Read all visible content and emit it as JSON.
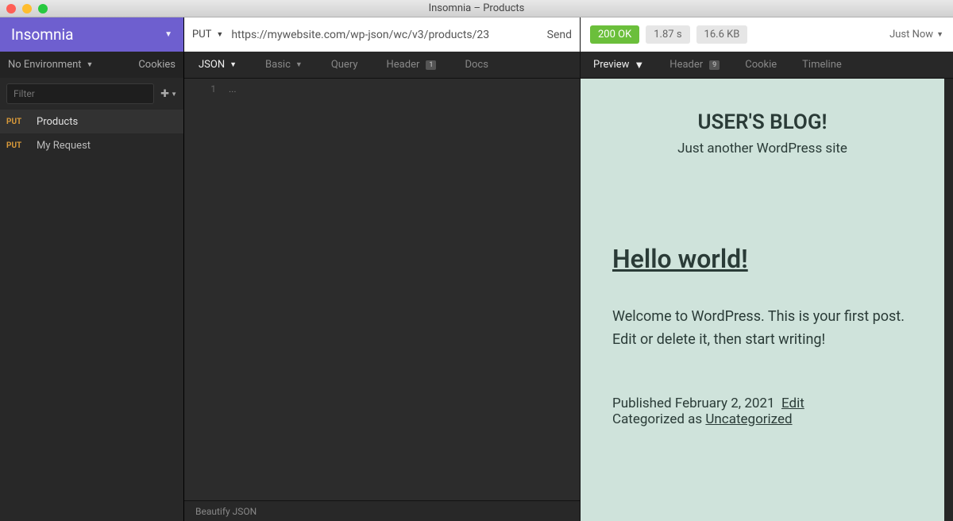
{
  "window": {
    "title": "Insomnia – Products"
  },
  "sidebar": {
    "brand": "Insomnia",
    "environment": "No Environment",
    "cookies": "Cookies",
    "filter_placeholder": "Filter",
    "requests": [
      {
        "method": "PUT",
        "name": "Products"
      },
      {
        "method": "PUT",
        "name": "My Request"
      }
    ]
  },
  "request": {
    "method": "PUT",
    "url": "https://mywebsite.com/wp-json/wc/v3/products/23",
    "send": "Send",
    "tabs": {
      "body": "JSON",
      "auth": "Basic",
      "query": "Query",
      "header": "Header",
      "header_badge": "1",
      "docs": "Docs"
    },
    "editor": {
      "line_num": "1",
      "content": "..."
    },
    "footer": "Beautify JSON"
  },
  "response": {
    "status": "200 OK",
    "time": "1.87 s",
    "size": "16.6 KB",
    "when": "Just Now",
    "tabs": {
      "preview": "Preview",
      "header": "Header",
      "header_badge": "9",
      "cookie": "Cookie",
      "timeline": "Timeline"
    },
    "preview": {
      "blog_title": "USER'S BLOG!",
      "tagline": "Just another WordPress site",
      "post_title": "Hello world!",
      "post_body": "Welcome to WordPress. This is your first post. Edit or delete it, then start writing!",
      "published_label": "Published ",
      "published_date": "February 2, 2021",
      "edit": "Edit",
      "categorized_label": "Categorized as ",
      "category": "Uncategorized"
    }
  }
}
